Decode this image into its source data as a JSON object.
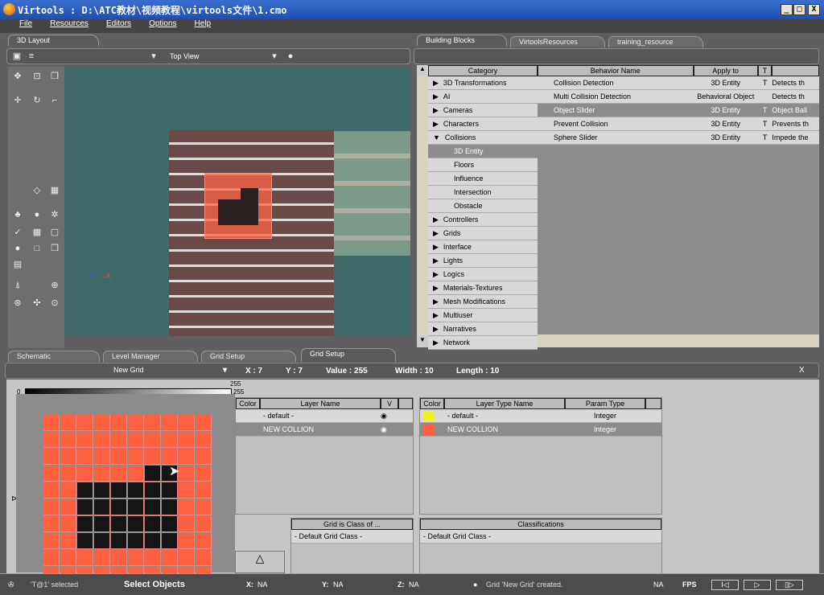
{
  "window": {
    "title": "Virtools : D:\\ATC教材\\视频教程\\virtools文件\\1.cmo",
    "min": "_",
    "max": "□",
    "close": "X"
  },
  "menu": [
    "File",
    "Resources",
    "Editors",
    "Options",
    "Help"
  ],
  "layout": {
    "tab": "3D Layout",
    "view": "Top View"
  },
  "building": {
    "tabs": [
      "Building Blocks",
      "VirtoolsResources",
      "training_resource"
    ],
    "cat_header": "Category",
    "columns": [
      "Behavior Name",
      "Apply to",
      "T"
    ],
    "categories": [
      {
        "label": "3D Transformations",
        "expand": "▶"
      },
      {
        "label": "AI",
        "expand": "▶"
      },
      {
        "label": "Cameras",
        "expand": "▶"
      },
      {
        "label": "Characters",
        "expand": "▶"
      },
      {
        "label": "Collisions",
        "expand": "▼"
      },
      {
        "label": "3D Entity",
        "sub": true,
        "sel": true
      },
      {
        "label": "Floors",
        "sub": true
      },
      {
        "label": "Influence",
        "sub": true
      },
      {
        "label": "Intersection",
        "sub": true
      },
      {
        "label": "Obstacle",
        "sub": true
      },
      {
        "label": "Controllers",
        "expand": "▶"
      },
      {
        "label": "Grids",
        "expand": "▶"
      },
      {
        "label": "Interface",
        "expand": "▶"
      },
      {
        "label": "Lights",
        "expand": "▶"
      },
      {
        "label": "Logics",
        "expand": "▶"
      },
      {
        "label": "Materials-Textures",
        "expand": "▶"
      },
      {
        "label": "Mesh Modifications",
        "expand": "▶"
      },
      {
        "label": "Multiuser",
        "expand": "▶"
      },
      {
        "label": "Narratives",
        "expand": "▶"
      },
      {
        "label": "Network",
        "expand": "▶"
      }
    ],
    "behaviors": [
      {
        "name": "Collision Detection",
        "apply": "3D Entity",
        "t": "T",
        "desc": "Detects th"
      },
      {
        "name": "Multi Collision Detection",
        "apply": "Behavioral Object",
        "t": "",
        "desc": "Detects th"
      },
      {
        "name": "Object Slider",
        "apply": "3D Entity",
        "t": "T",
        "desc": "Object Ball",
        "sel": true
      },
      {
        "name": "Prevent Collision",
        "apply": "3D Entity",
        "t": "T",
        "desc": "Prevents th"
      },
      {
        "name": "Sphere Slider",
        "apply": "3D Entity",
        "t": "T",
        "desc": "Impede the"
      }
    ]
  },
  "bottom_tabs": [
    "Schematic",
    "Level Manager",
    "Grid Setup",
    "Grid Setup"
  ],
  "grid": {
    "name": "New Grid",
    "x": "X : 7",
    "y": "Y : 7",
    "value": "Value : 255",
    "width": "Width : 10",
    "length": "Length : 10",
    "close": "X",
    "scale_min": "0",
    "scale_max": "255",
    "scale_max2": "255",
    "fill_color": "#ff6040",
    "black_color": "#151515",
    "layers": {
      "headers": [
        "Color",
        "Layer Name",
        "V"
      ],
      "rows": [
        {
          "name": "- default -"
        },
        {
          "name": "NEW COLLION",
          "sel": true
        }
      ]
    },
    "layer_types": {
      "headers": [
        "Color",
        "Layer Type Name",
        "Param Type"
      ],
      "rows": [
        {
          "name": "- default -",
          "type": "Integer",
          "color": "#f0f020"
        },
        {
          "name": "NEW COLLION",
          "type": "Integer",
          "color": "#ff6040",
          "sel": true
        }
      ]
    },
    "class_of": {
      "header": "Grid is Class of ...",
      "row": "- Default Grid Class -"
    },
    "classifications": {
      "header": "Classifications",
      "row": "- Default Grid Class -"
    }
  },
  "status": {
    "selected": "'T@1' selected",
    "mode": "Select Objects",
    "x": "X:",
    "xv": "NA",
    "y": "Y:",
    "yv": "NA",
    "z": "Z:",
    "zv": "NA",
    "message": "Grid 'New Grid' created.",
    "fps_val": "NA",
    "fps": "FPS"
  }
}
